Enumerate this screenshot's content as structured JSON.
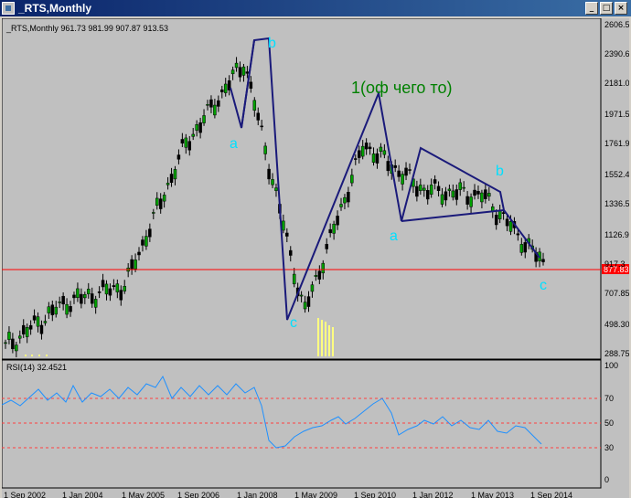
{
  "window": {
    "title": "_RTS,Monthly",
    "buttons": {
      "minimize": "_",
      "maximize": "□",
      "close": "×"
    }
  },
  "main_panel": {
    "info": "_RTS,Monthly  961.73 981.99 907.87 913.53",
    "y_ticks": [
      "2606.5",
      "2390.65",
      "2181.0",
      "1971.5",
      "1761.9",
      "1552.4",
      "1336.5",
      "1126.9",
      "917.3",
      "707.85",
      "498.30",
      "288.75"
    ],
    "price_label": "877.83",
    "annotations": {
      "top_label": "1(оф чего то)",
      "wave_a1": "a",
      "wave_b1": "b",
      "wave_c1": "c",
      "wave_a2": "a",
      "wave_b2": "b",
      "wave_c2": "c"
    }
  },
  "rsi_panel": {
    "info": "RSI(14) 32.4521",
    "y_ticks": [
      "100",
      "70",
      "50",
      "30",
      "0"
    ]
  },
  "x_axis": {
    "labels": [
      "1 Sep 2002",
      "1 Jan 2004",
      "1 May 2005",
      "1 Sep 2006",
      "1 Jan 2008",
      "1 May 2009",
      "1 Sep 2010",
      "1 Jan 2012",
      "1 May 2013",
      "1 Sep 2014"
    ]
  },
  "colors": {
    "chart_bg": "#c0c0c0",
    "candle": "#00a000",
    "wave_line": "#1a1a7a",
    "label_cyan": "#00e0ff",
    "label_green": "#008000",
    "current_price_line": "#ff0000",
    "rsi_line": "#1e90ff"
  },
  "chart_data": {
    "type": "line",
    "x": [
      "1 Sep 2002",
      "1 Jan 2004",
      "1 May 2005",
      "1 Sep 2006",
      "1 Jan 2008",
      "1 May 2009",
      "1 Sep 2010",
      "1 Jan 2012",
      "1 May 2013",
      "1 Sep 2014"
    ],
    "series": [
      {
        "name": "_RTS,Monthly",
        "values": [
          330,
          640,
          760,
          1740,
          2330,
          570,
          1750,
          1430,
          1390,
          914
        ]
      },
      {
        "name": "RSI(14)",
        "values": [
          66,
          67,
          72,
          70,
          72,
          28,
          51,
          47,
          45,
          32
        ]
      }
    ],
    "ylim": [
      288.75,
      2606.5
    ],
    "rsi_levels": [
      70,
      50,
      30
    ]
  }
}
